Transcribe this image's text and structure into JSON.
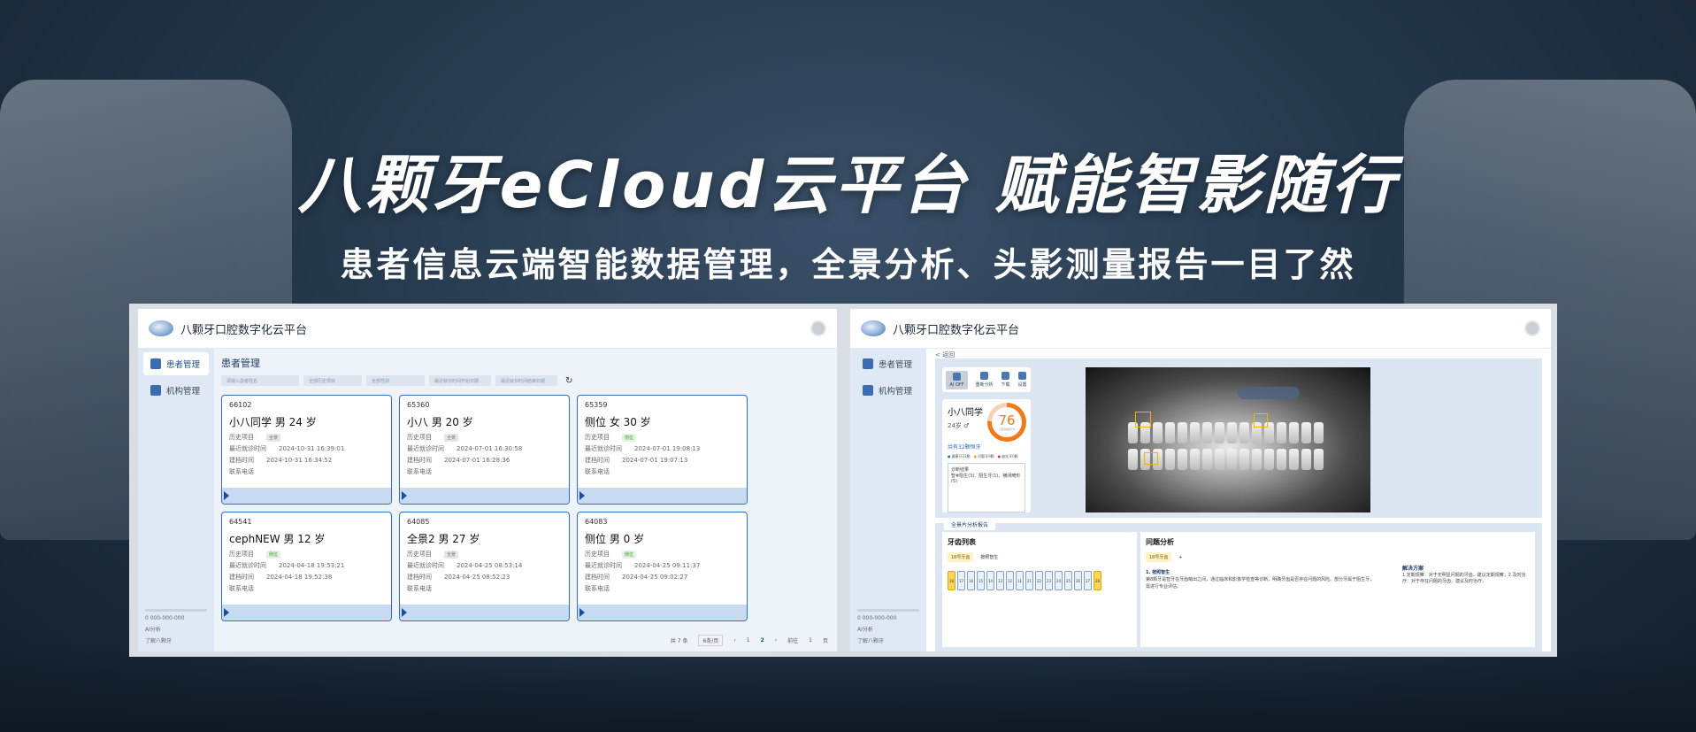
{
  "banner": {
    "headline": "八颗牙eCloud云平台 赋能智影随行",
    "subline": "患者信息云端智能数据管理，全景分析、头影测量报告一目了然"
  },
  "app": {
    "brand": "八颗牙口腔数字化云平台"
  },
  "left_panel": {
    "sidebar": [
      {
        "label": "患者管理"
      },
      {
        "label": "机构管理"
      }
    ],
    "sidebar_footer": {
      "phone": "0 000-000-000",
      "line2": "AI分析",
      "line3": "了解八颗牙"
    },
    "page_title": "患者管理",
    "filters": [
      "请输入患者姓名",
      "全部历史项目",
      "全部性别",
      "最近就诊时间开始日期",
      "最近就诊时间结束日期"
    ],
    "cards": [
      {
        "id": "66102",
        "name": "小八同学  男  24 岁",
        "history_label": "历史项目",
        "tag": "全景",
        "tag_green": false,
        "recent_label": "最近就诊时间",
        "recent": "2024-10-31 16:39:01",
        "created_label": "建档时间",
        "created": "2024-10-31 16:34:52",
        "phone_label": "联系电话"
      },
      {
        "id": "65360",
        "name": "小八  男  20 岁",
        "history_label": "历史项目",
        "tag": "全景",
        "tag_green": false,
        "recent_label": "最近就诊时间",
        "recent": "2024-07-01 16:30:58",
        "created_label": "建档时间",
        "created": "2024-07-01 16:28:36",
        "phone_label": "联系电话"
      },
      {
        "id": "65359",
        "name": "侧位  女  30 岁",
        "history_label": "历史项目",
        "tag": "侧位",
        "tag_green": true,
        "recent_label": "最近就诊时间",
        "recent": "2024-07-01 19:08:13",
        "created_label": "建档时间",
        "created": "2024-07-01 19:07:13",
        "phone_label": "联系电话"
      },
      {
        "id": "64541",
        "name": "cephNEW  男  12 岁",
        "history_label": "历史项目",
        "tag": "侧位",
        "tag_green": true,
        "recent_label": "最近就诊时间",
        "recent": "2024-04-18 19:53:21",
        "created_label": "建档时间",
        "created": "2024-04-18 19:52:38",
        "phone_label": "联系电话"
      },
      {
        "id": "64085",
        "name": "全景2  男  27 岁",
        "history_label": "历史项目",
        "tag": "全景",
        "tag_green": false,
        "recent_label": "最近就诊时间",
        "recent": "2024-04-25 08:53:14",
        "created_label": "建档时间",
        "created": "2024-04-25 08:52:23",
        "phone_label": "联系电话"
      },
      {
        "id": "64083",
        "name": "侧位  男  0 岁",
        "history_label": "历史项目",
        "tag": "侧位",
        "tag_green": true,
        "recent_label": "最近就诊时间",
        "recent": "2024-04-25 09:11:37",
        "created_label": "建档时间",
        "created": "2024-04-25 09:02:27",
        "phone_label": "联系电话"
      }
    ],
    "pager": {
      "total": "共 7 条",
      "size": "6条/页",
      "p1": "1",
      "p2": "2",
      "goto": "前往",
      "goto_val": "1",
      "page_unit": "页"
    }
  },
  "right_panel": {
    "sidebar": [
      {
        "label": "患者管理"
      },
      {
        "label": "机构管理"
      }
    ],
    "back": "< 返回",
    "tools": [
      {
        "label": "AI OFF"
      },
      {
        "label": "重新分析"
      },
      {
        "label": "下载"
      },
      {
        "label": "设置"
      }
    ],
    "patient": {
      "name": "小八同学",
      "age": "24岁 ♂",
      "score": "76",
      "score_caption": "口腔健康评分",
      "teeth_link": "共有32颗恒牙",
      "legend": [
        "健康牙23颗",
        "问题牙9颗",
        "缺失牙0颗"
      ],
      "diag_title": "诊断结果",
      "diag_text": "智#阻生(3)、阻生牙(1)、横闭畸形(5)"
    },
    "report": {
      "tab": "全景片分析报告",
      "tooth_list_title": "牙齿列表",
      "chips": [
        "18号牙齿",
        "按照智生"
      ],
      "tooth_numbers": [
        "18",
        "17",
        "16",
        "15",
        "14",
        "13",
        "12",
        "11",
        "21",
        "22",
        "23",
        "24",
        "25",
        "26",
        "27",
        "28"
      ],
      "yellow_teeth": [
        0,
        15
      ],
      "issue_title": "问题分析",
      "issue_chip": "18号牙齿",
      "issue_heading": "1. 按照智生",
      "issue_body": "第8颗牙是智牙在牙齿萌出之间，通过临床和影像学检查等诊断，明确牙齿是否存在问题的风险。部分牙属于阻生牙，需进行专业评估。",
      "plan_title": "解决方案",
      "plan_body": "1.定期观察：对于无明显问题的牙齿，建议定期观察；2.及时治疗：对于存在问题的牙齿，建议及时治疗。"
    }
  }
}
